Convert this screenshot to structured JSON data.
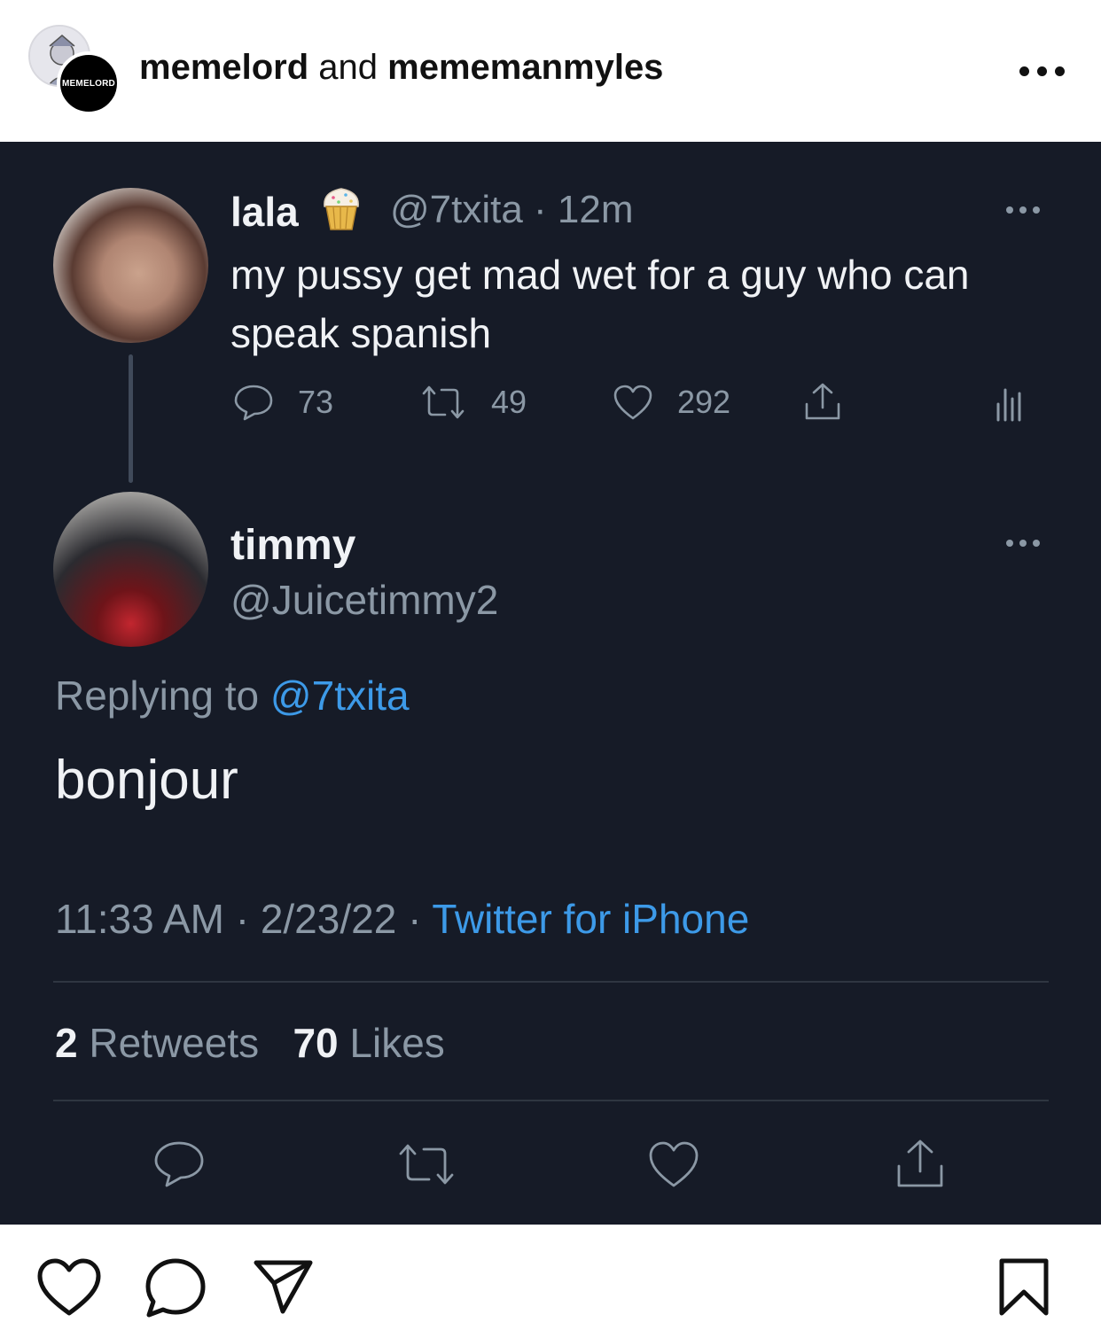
{
  "header": {
    "avatar_logo_text": "MEMELORD",
    "author_primary": "memelord",
    "author_conjunction": " and ",
    "author_secondary": "mememanmyles"
  },
  "tweet": {
    "original": {
      "name": "lala",
      "emoji": "cupcake",
      "handle_time": "@7txita · 12m",
      "text": "my pussy get mad wet for a guy who can speak spanish",
      "reply_count": "73",
      "retweet_count": "49",
      "like_count": "292"
    },
    "reply": {
      "name": "timmy",
      "handle": "@Juicetimmy2",
      "replying_to_label": "Replying to ",
      "replying_to_handle": "@7txita",
      "text": "bonjour",
      "time_date": "11:33 AM · 2/23/22 · ",
      "source": "Twitter for iPhone",
      "retweets_count": "2",
      "retweets_label": " Retweets",
      "likes_count": "70",
      "likes_label": " Likes"
    }
  },
  "icons": {
    "header_more": "ellipsis-icon",
    "footer": [
      "heart-icon",
      "comment-icon",
      "share-icon",
      "bookmark-icon"
    ]
  },
  "colors": {
    "tweet_bg": "#161b27",
    "link_blue": "#3d9ae8",
    "muted": "#8b98a5"
  }
}
